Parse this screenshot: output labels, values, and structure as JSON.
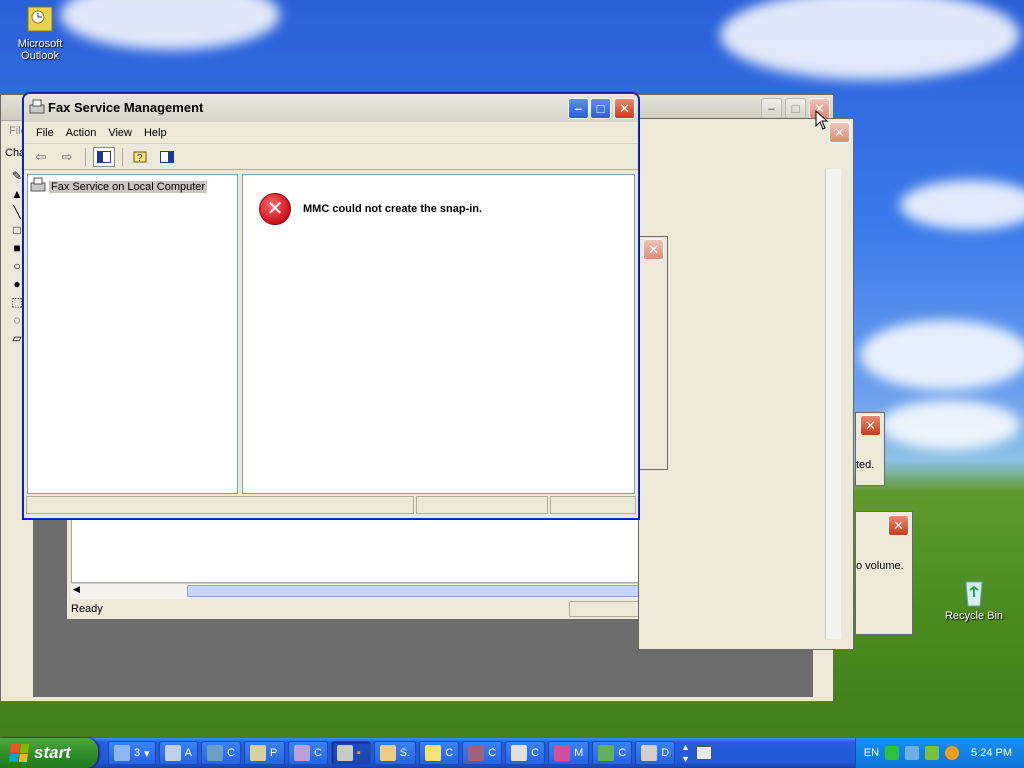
{
  "desktop": {
    "icons": [
      {
        "label_line1": "Microsoft",
        "label_line2": "Outlook",
        "icon": "outlook-icon"
      },
      {
        "label_line1": "Recycle Bin",
        "label_line2": "",
        "icon": "recycle-bin-icon"
      }
    ]
  },
  "fax_window": {
    "title": "Fax Service Management",
    "menu": [
      "File",
      "Action",
      "View",
      "Help"
    ],
    "toolbar_icons": [
      "back-icon",
      "forward-icon",
      "show-hide-tree-icon",
      "help-icon",
      "show-hide-action-pane-icon"
    ],
    "tree_item": "Fax Service on Local Computer",
    "error_message": "MMC could not create the snap-in."
  },
  "paint_window": {
    "menu_fragment": "File",
    "status": "Ready",
    "left_fragment": "Cha"
  },
  "background_dialogs": {
    "fragment_1": "ted.",
    "fragment_2": "o volume."
  },
  "taskbar": {
    "start_label": "start",
    "quicklaunch_count": "3",
    "tasks": [
      {
        "label": "A",
        "icon": "network-icon"
      },
      {
        "label": "C",
        "icon": "console-icon"
      },
      {
        "label": "P.",
        "icon": "paint-icon"
      },
      {
        "label": "C",
        "icon": "component-icon"
      },
      {
        "label": "",
        "icon": "fax-icon"
      },
      {
        "label": "S.",
        "icon": "scan-icon"
      },
      {
        "label": "C",
        "icon": "help-icon"
      },
      {
        "label": "C",
        "icon": "book-icon"
      },
      {
        "label": "C",
        "icon": "document-icon"
      },
      {
        "label": "M",
        "icon": "mmc-icon"
      },
      {
        "label": "C",
        "icon": "setup-icon"
      },
      {
        "label": "D",
        "icon": "disk-icon"
      }
    ],
    "language": "EN",
    "clock": "5:24 PM"
  }
}
